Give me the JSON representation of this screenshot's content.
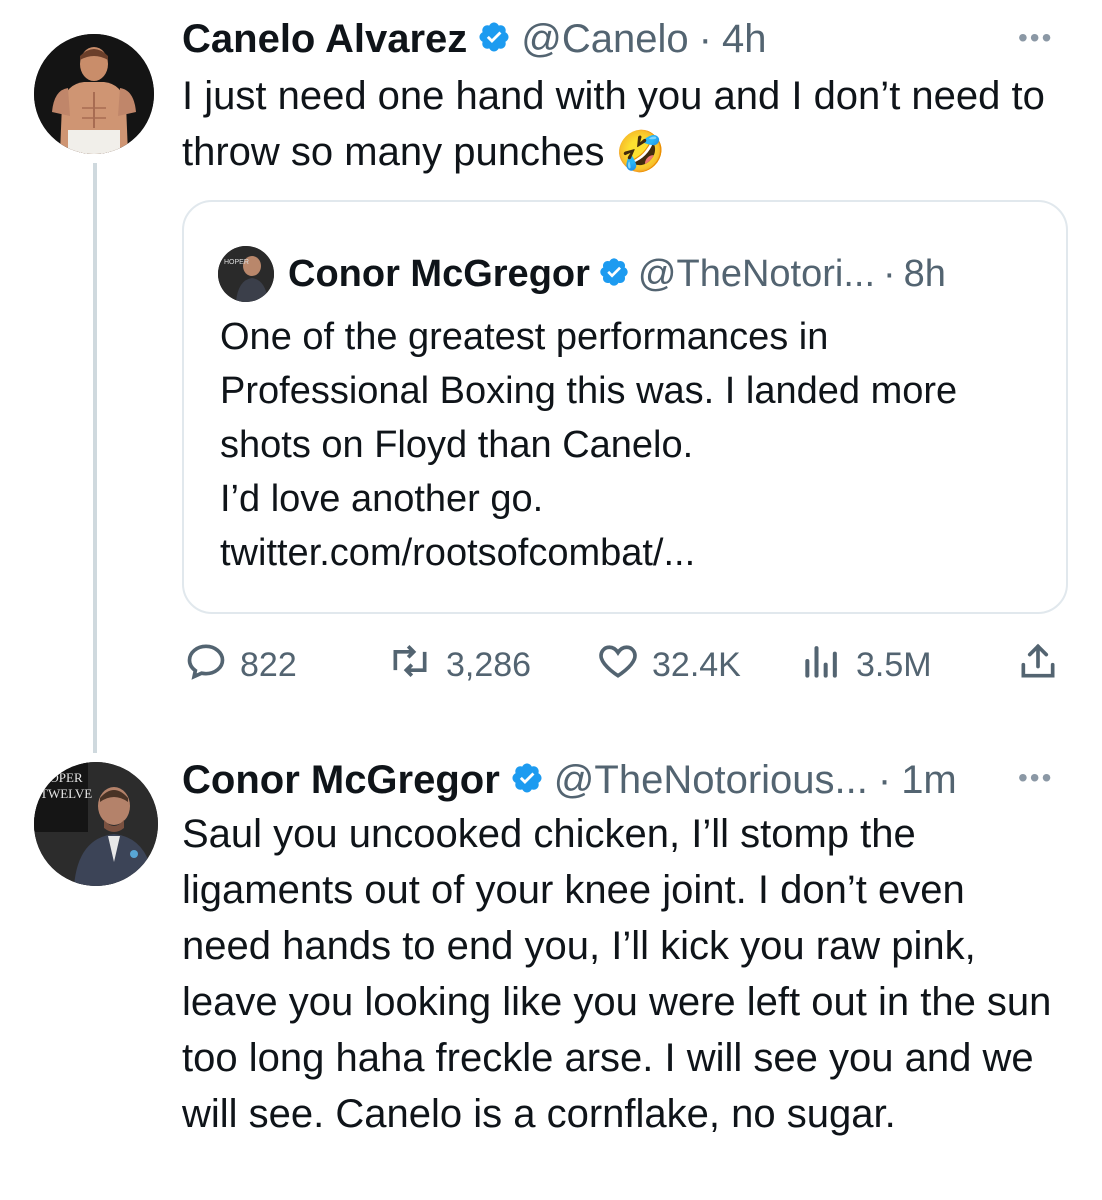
{
  "tweet1": {
    "name": "Canelo Alvarez",
    "handle": "@Canelo",
    "sep": "·",
    "time": "4h",
    "more": "•••",
    "text": "I just need one hand with you and I don’t need to throw so many punches 🤣",
    "quote": {
      "name": "Conor McGregor",
      "handle": "@TheNotori...",
      "sep": "·",
      "time": "8h",
      "text": "One of the greatest performances in Professional Boxing this was. I landed more shots on Floyd than Canelo.\nI’d love another go. twitter.com/rootsofcombat/..."
    },
    "actions": {
      "replies": "822",
      "retweets": "3,286",
      "likes": "32.4K",
      "views": "3.5M"
    }
  },
  "tweet2": {
    "name": "Conor McGregor",
    "handle": "@TheNotorious...",
    "sep": "·",
    "time": "1m",
    "more": "•••",
    "text": "Saul you uncooked chicken, I’ll stomp the ligaments out of your knee joint. I don’t even need hands to end you, I’ll kick you raw pink, leave you looking like you were left out in the sun too long haha freckle arse. I will see you and we will see. Canelo is a cornflake, no sugar.",
    "avatar_text": [
      "HOPER",
      "TWELVE"
    ]
  },
  "colors": {
    "text": "#0f1419",
    "secondary": "#536471",
    "verified": "#1d9bf0",
    "border": "#e1e8ed"
  }
}
